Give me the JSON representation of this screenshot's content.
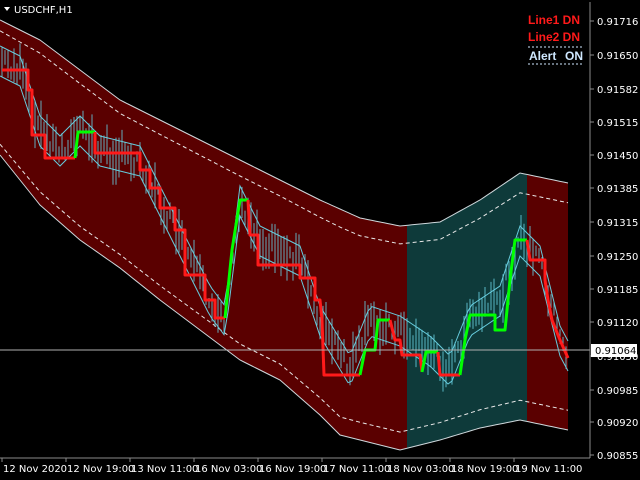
{
  "chart_title": "USDCHF,H1",
  "status": {
    "line1": "Line1 DN",
    "line2": "Line2 DN",
    "alert_label": "Alert",
    "alert_value": "ON"
  },
  "colors": {
    "background": "#000000",
    "band_fill_down": "#5a0000",
    "band_fill_up": "#0e3a3a",
    "price": "#66ccdd",
    "line_up": "#00ff00",
    "line_down": "#ff1a1a",
    "status_down": "#ff1a1a",
    "alert_text": "#cfe8ff"
  },
  "chart_data": {
    "type": "line",
    "title": "USDCHF,H1",
    "x": [
      "12 Nov 2020",
      "12 Nov 19:00",
      "13 Nov 11:00",
      "16 Nov 03:00",
      "16 Nov 19:00",
      "17 Nov 11:00",
      "18 Nov 03:00",
      "18 Nov 19:00",
      "19 Nov 11:00"
    ],
    "y_ticks": [
      "0.91716",
      "0.91650",
      "0.91582",
      "0.91515",
      "0.91450",
      "0.91385",
      "0.91315",
      "0.91250",
      "0.91185",
      "0.91120",
      "0.91050",
      "0.90985",
      "0.90920",
      "0.90855"
    ],
    "ylim": [
      0.90855,
      0.91716
    ],
    "current_price": "0.91064",
    "signal_line": {
      "green_segments": [
        "13 Nov morning",
        "16 Nov 02:00 - 16 Nov 05:00",
        "17 Nov 17:00 - 17 Nov 22:00",
        "18 Nov 05:00",
        "18 Nov 17:00 - 18 Nov 23:00",
        "19 Nov 04:00 - 19 Nov 07:00"
      ],
      "red_segments": "all other periods"
    },
    "band_zones": [
      {
        "from": "12 Nov 2020",
        "to": "18 Nov 03:00",
        "trend": "down"
      },
      {
        "from": "18 Nov 03:00",
        "to": "19 Nov 05:00",
        "trend": "up"
      },
      {
        "from": "19 Nov 05:00",
        "to": "19 Nov 11:00",
        "trend": "down"
      }
    ]
  }
}
